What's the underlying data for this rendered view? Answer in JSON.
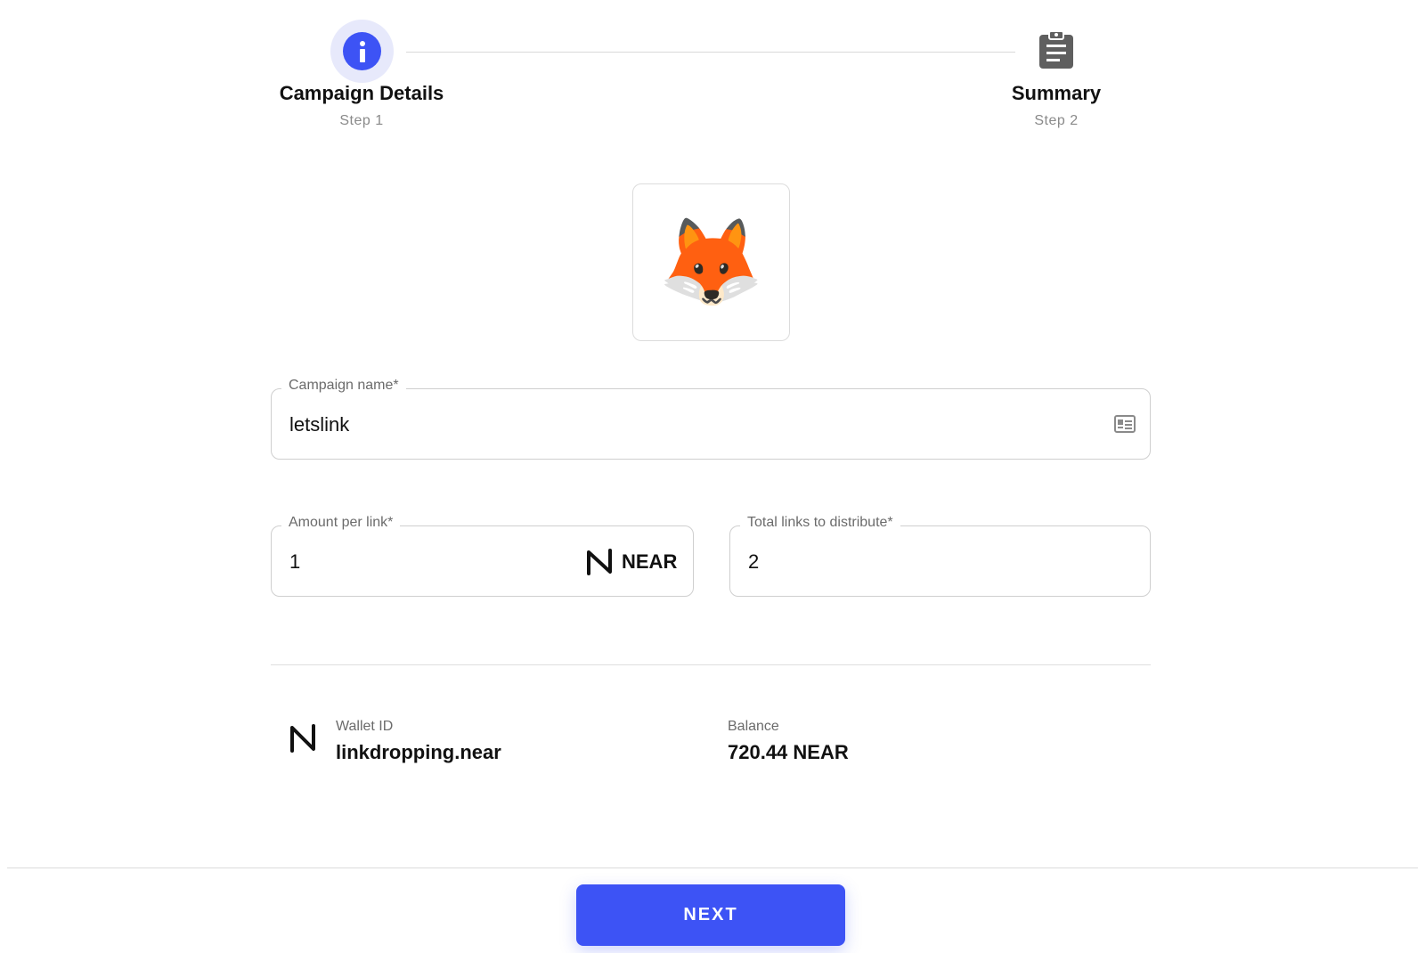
{
  "stepper": {
    "steps": [
      {
        "title": "Campaign Details",
        "subtitle": "Step 1",
        "icon": "info-icon",
        "active": true
      },
      {
        "title": "Summary",
        "subtitle": "Step 2",
        "icon": "clipboard-icon",
        "active": false
      }
    ]
  },
  "campaign_image": {
    "icon": "fox-emoji",
    "emoji": "🦊"
  },
  "form": {
    "campaign_name": {
      "label": "Campaign name*",
      "value": "letslink",
      "icon": "contact-card-icon"
    },
    "amount_per_link": {
      "label": "Amount per link*",
      "value": "1",
      "unit": "NEAR",
      "unit_icon": "near-logo-icon"
    },
    "total_links": {
      "label": "Total links to distribute*",
      "value": "2"
    }
  },
  "wallet": {
    "id_label": "Wallet ID",
    "id_value": "linkdropping.near",
    "balance_label": "Balance",
    "balance_value": "720.44 NEAR"
  },
  "actions": {
    "next_label": "NEXT"
  },
  "colors": {
    "accent": "#3d53f5",
    "accent_soft": "#e7e9fb",
    "border": "#cfcfcf",
    "muted": "#8a8a8a"
  }
}
